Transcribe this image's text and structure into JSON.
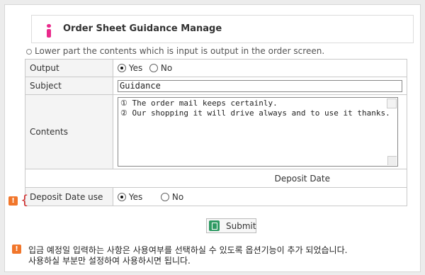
{
  "header": {
    "title": "Order Sheet Guidance Manage"
  },
  "note": "Lower part the contents which is input is output in the order screen.",
  "form": {
    "output": {
      "label": "Output",
      "yes": "Yes",
      "no": "No"
    },
    "subject": {
      "label": "Subject",
      "value": "Guidance"
    },
    "contents": {
      "label": "Contents",
      "line1": "① The order mail keeps certainly.",
      "line2": "② Our shopping it will drive always and to use it thanks."
    },
    "deposit_date": {
      "header": "Deposit Date",
      "use_label": "Deposit Date use",
      "yes": "Yes",
      "no": "No"
    }
  },
  "submit_label": "Submit",
  "info": {
    "line1": "입금 예정일 입력하는 사항은 사용여부를 선택하실 수 있도록 옵션기능이 추가 되었습니다.",
    "line2": "사용하실 부분만 설정하여 사용하시면 됩니다."
  },
  "colors": {
    "accent": "#ea2a8c",
    "warning": "#f1762b",
    "submit_icon": "#2e9a63"
  }
}
